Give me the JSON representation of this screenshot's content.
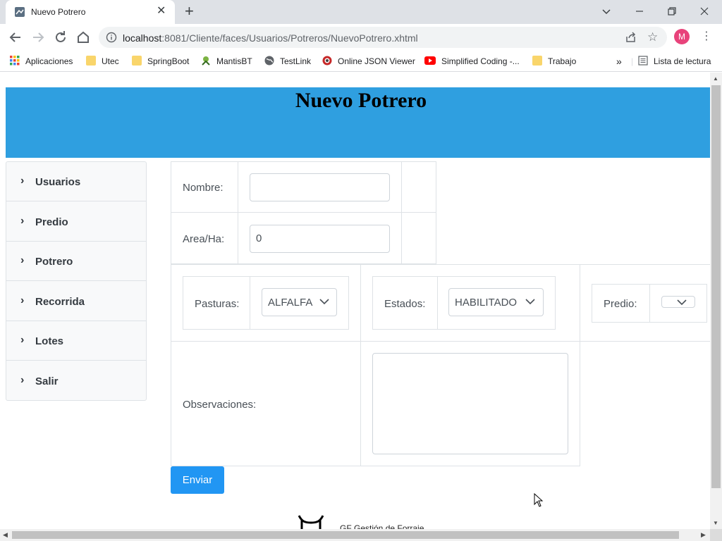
{
  "browser": {
    "tab_title": "Nuevo Potrero",
    "tab_close": "✕",
    "new_tab": "+",
    "url_host": "localhost",
    "url_rest": ":8081/Cliente/faces/Usuarios/Potreros/NuevoPotrero.xhtml",
    "avatar_letter": "M",
    "bookmarks": [
      {
        "label": "Aplicaciones",
        "icon": "apps-grid-icon"
      },
      {
        "label": "Utec",
        "icon": "folder-icon"
      },
      {
        "label": "SpringBoot",
        "icon": "folder-icon"
      },
      {
        "label": "MantisBT",
        "icon": "mantis-icon"
      },
      {
        "label": "TestLink",
        "icon": "globe-icon"
      },
      {
        "label": "Online JSON Viewer",
        "icon": "json-viewer-icon"
      },
      {
        "label": "Simplified Coding -...",
        "icon": "youtube-icon"
      },
      {
        "label": "Trabajo",
        "icon": "folder-icon"
      }
    ],
    "bookmarks_overflow": "»",
    "reading_list": "Lista de lectura"
  },
  "page": {
    "title": "Nuevo Potrero",
    "menu": [
      {
        "label": "Usuarios"
      },
      {
        "label": "Predio"
      },
      {
        "label": "Potrero"
      },
      {
        "label": "Recorrida"
      },
      {
        "label": "Lotes"
      },
      {
        "label": "Salir"
      }
    ],
    "form": {
      "nombre_label": "Nombre:",
      "nombre_value": "",
      "area_label": "Area/Ha:",
      "area_value": "0",
      "pasturas_label": "Pasturas:",
      "pasturas_value": "ALFALFA",
      "estados_label": "Estados:",
      "estados_value": "HABILITADO",
      "predio_label": "Predio:",
      "predio_value": "",
      "observaciones_label": "Observaciones:",
      "observaciones_value": ""
    },
    "submit_label": "Enviar",
    "footer_text": "GF Gestión de Forraje"
  },
  "colors": {
    "header_band": "#2f9fe0",
    "button_primary": "#2196f3"
  }
}
